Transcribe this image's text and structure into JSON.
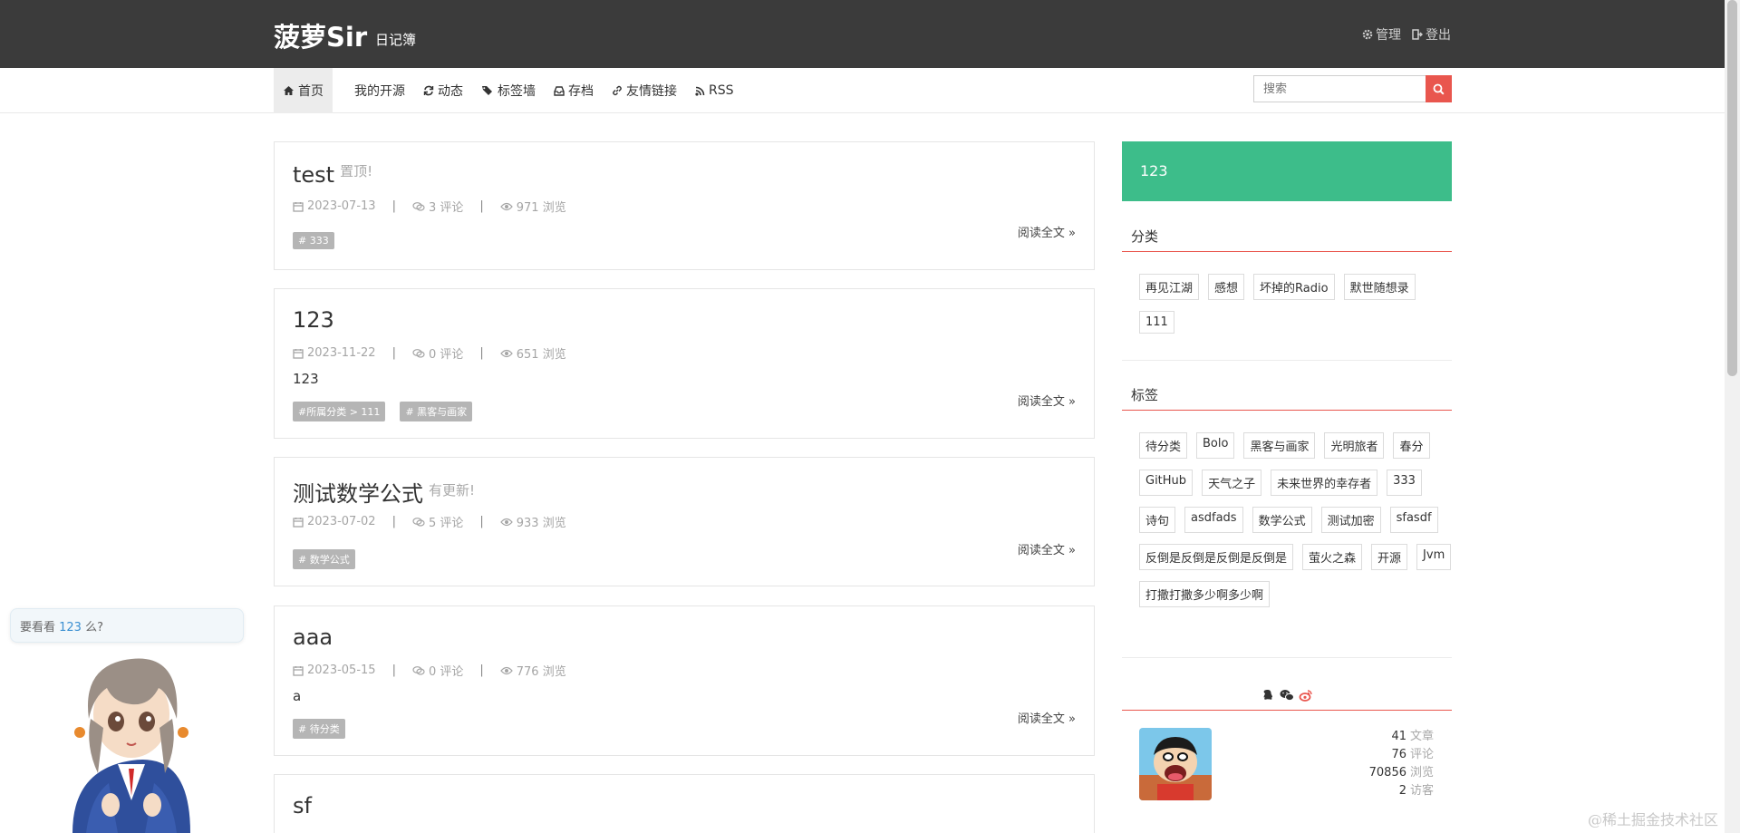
{
  "header": {
    "brand": "菠萝Sir",
    "subtitle": "日记簿",
    "actions": [
      {
        "icon": "gear-icon",
        "label": "管理"
      },
      {
        "icon": "logout-icon",
        "label": "登出"
      }
    ]
  },
  "nav": {
    "items": [
      {
        "icon": "home-icon",
        "label": "首页",
        "active": true
      },
      {
        "icon": "",
        "label": "我的开源"
      },
      {
        "icon": "refresh-icon",
        "label": "动态"
      },
      {
        "icon": "tags-icon",
        "label": "标签墙"
      },
      {
        "icon": "inbox-icon",
        "label": "存档"
      },
      {
        "icon": "link-icon",
        "label": "友情链接"
      },
      {
        "icon": "rss-icon",
        "label": "RSS"
      }
    ],
    "search_placeholder": "搜索"
  },
  "posts": [
    {
      "title": "test",
      "badge": "置顶!",
      "date": "2023-07-13",
      "comments": "3 评论",
      "views": "971 浏览",
      "excerpt": "",
      "tags": [
        "# 333"
      ],
      "read_more": "阅读全文 »"
    },
    {
      "title": "123",
      "badge": "",
      "date": "2023-11-22",
      "comments": "0 评论",
      "views": "651 浏览",
      "excerpt": "123",
      "tags": [
        "#所属分类 > 111",
        "# 黑客与画家"
      ],
      "read_more": "阅读全文 »"
    },
    {
      "title": "测试数学公式",
      "badge": "有更新!",
      "date": "2023-07-02",
      "comments": "5 评论",
      "views": "933 浏览",
      "excerpt": "",
      "tags": [
        "# 数学公式"
      ],
      "read_more": "阅读全文 »"
    },
    {
      "title": "aaa",
      "badge": "",
      "date": "2023-05-15",
      "comments": "0 评论",
      "views": "776 浏览",
      "excerpt": "a",
      "tags": [
        "# 待分类"
      ],
      "read_more": "阅读全文 »"
    },
    {
      "title": "sf",
      "badge": "",
      "date": "",
      "comments": "",
      "views": "",
      "excerpt": "",
      "tags": [],
      "read_more": ""
    }
  ],
  "sidebar": {
    "banner": "123",
    "categories_title": "分类",
    "categories": [
      "再见江湖",
      "感想",
      "坏掉的Radio",
      "默世随想录",
      "111"
    ],
    "tags_title": "标签",
    "tags": [
      "待分类",
      "Bolo",
      "黑客与画家",
      "光明旅者",
      "春分",
      "GitHub",
      "天气之子",
      "未来世界的幸存者",
      "333",
      "诗句",
      "asdfads",
      "数学公式",
      "测试加密",
      "sfasdf",
      "反倒是反倒是反倒是反倒是",
      "萤火之森",
      "开源",
      "Jvm",
      "打撒打撒多少啊多少啊"
    ],
    "social_icons": [
      "qq-icon",
      "wechat-icon",
      "weibo-icon"
    ],
    "stats": [
      {
        "value": "41",
        "label": "文章"
      },
      {
        "value": "76",
        "label": "评论"
      },
      {
        "value": "70856",
        "label": "浏览"
      },
      {
        "value": "2",
        "label": "访客"
      }
    ]
  },
  "mascot": {
    "bubble_prefix": "要看看 ",
    "bubble_link": "123",
    "bubble_suffix": " 么?"
  },
  "watermark": "@稀土掘金技术社区",
  "colors": {
    "header_bg": "#3b3b3b",
    "accent_red": "#e9564e",
    "banner_green": "#3dbd8a"
  }
}
